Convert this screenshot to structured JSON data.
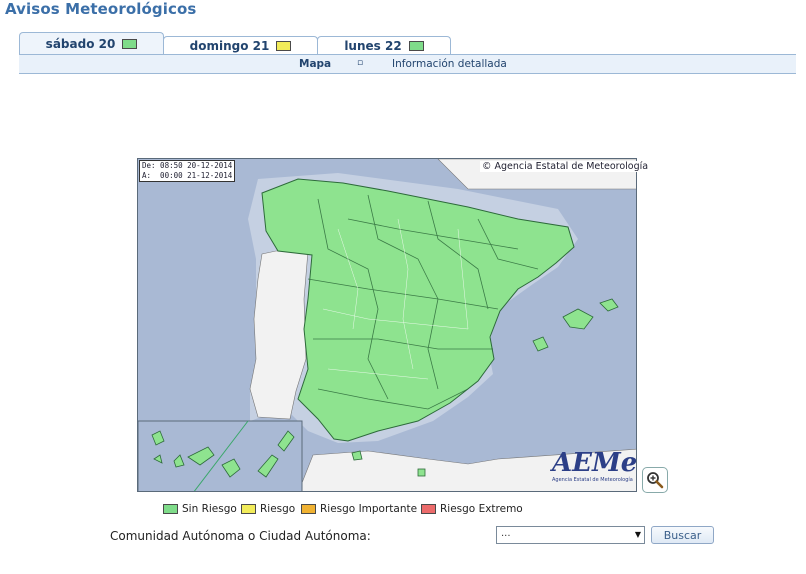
{
  "page": {
    "title": "Avisos Meteorológicos"
  },
  "tabs": [
    {
      "label": "sábado 20",
      "swatch": "#7fdc8a"
    },
    {
      "label": "domingo 21",
      "swatch": "#f2ec5a"
    },
    {
      "label": "lunes 22",
      "swatch": "#7fdc8a"
    }
  ],
  "subnav": {
    "map_label": "Mapa",
    "separator": "▫",
    "detail_label": "Información detallada"
  },
  "map": {
    "timestamp_from": "De: 08:50 20-12-2014",
    "timestamp_to": "A:  00:00 21-12-2014",
    "credit": "© Agencia Estatal de Meteorología",
    "logo_text": "AEMet",
    "logo_subtitle": "Agencia Estatal de Meteorología",
    "zoom_icon": "magnifier-plus-icon",
    "colors": {
      "sea": "#a9b9d4",
      "land": "#f0f0f0",
      "sin_riesgo": "#8ee38f",
      "province_border": "#2d6a3a"
    }
  },
  "legend": [
    {
      "label": "Sin Riesgo",
      "color": "#7fdc8a"
    },
    {
      "label": "Riesgo",
      "color": "#f2ec5a"
    },
    {
      "label": "Riesgo Importante",
      "color": "#f0b232"
    },
    {
      "label": "Riesgo Extremo",
      "color": "#ec6b6b"
    }
  ],
  "search": {
    "label": "Comunidad Autónoma o Ciudad Autónoma:",
    "select_value": "...",
    "button_label": "Buscar"
  }
}
